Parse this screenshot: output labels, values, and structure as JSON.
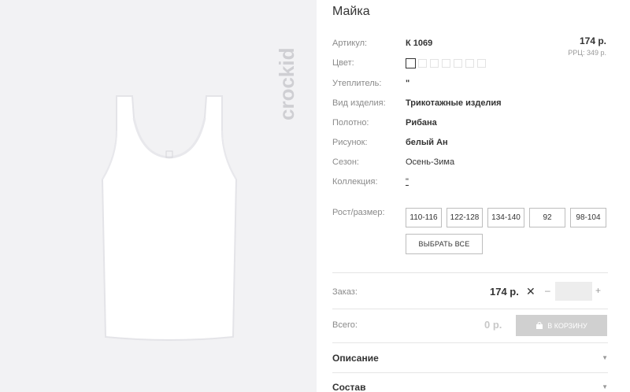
{
  "product": {
    "title": "Майка",
    "price": "174 р.",
    "rrp_label": "РРЦ:",
    "rrp_value": "349 р.",
    "brand": "crockid"
  },
  "attributes": [
    {
      "label": "Артикул:",
      "value": "К 1069"
    },
    {
      "label": "Цвет:",
      "value": ""
    },
    {
      "label": "Утеплитель:",
      "value": "\""
    },
    {
      "label": "Вид изделия:",
      "value": "Трикотажные изделия"
    },
    {
      "label": "Полотно:",
      "value": "Рибана"
    },
    {
      "label": "Рисунок:",
      "value": "белый Ан"
    },
    {
      "label": "Сезон:",
      "value": "Осень-Зима"
    },
    {
      "label": "Коллекция:",
      "value": "\""
    }
  ],
  "colors": {
    "swatch_count": 7,
    "selected_index": 0
  },
  "sizes": {
    "label": "Рост/размер:",
    "options": [
      "110-116",
      "122-128",
      "134-140",
      "92",
      "98-104"
    ],
    "select_all": "ВЫБРАТЬ ВСЕ"
  },
  "order": {
    "label": "Заказ:",
    "price": "174 р.",
    "times": "✕",
    "minus": "–",
    "plus": "+",
    "quantity": ""
  },
  "total": {
    "label": "Всего:",
    "value": "0 р.",
    "cart_button": "В КОРЗИНУ"
  },
  "accordions": [
    {
      "title": "Описание",
      "arrow": "▼"
    },
    {
      "title": "Состав",
      "arrow": "▼"
    }
  ]
}
